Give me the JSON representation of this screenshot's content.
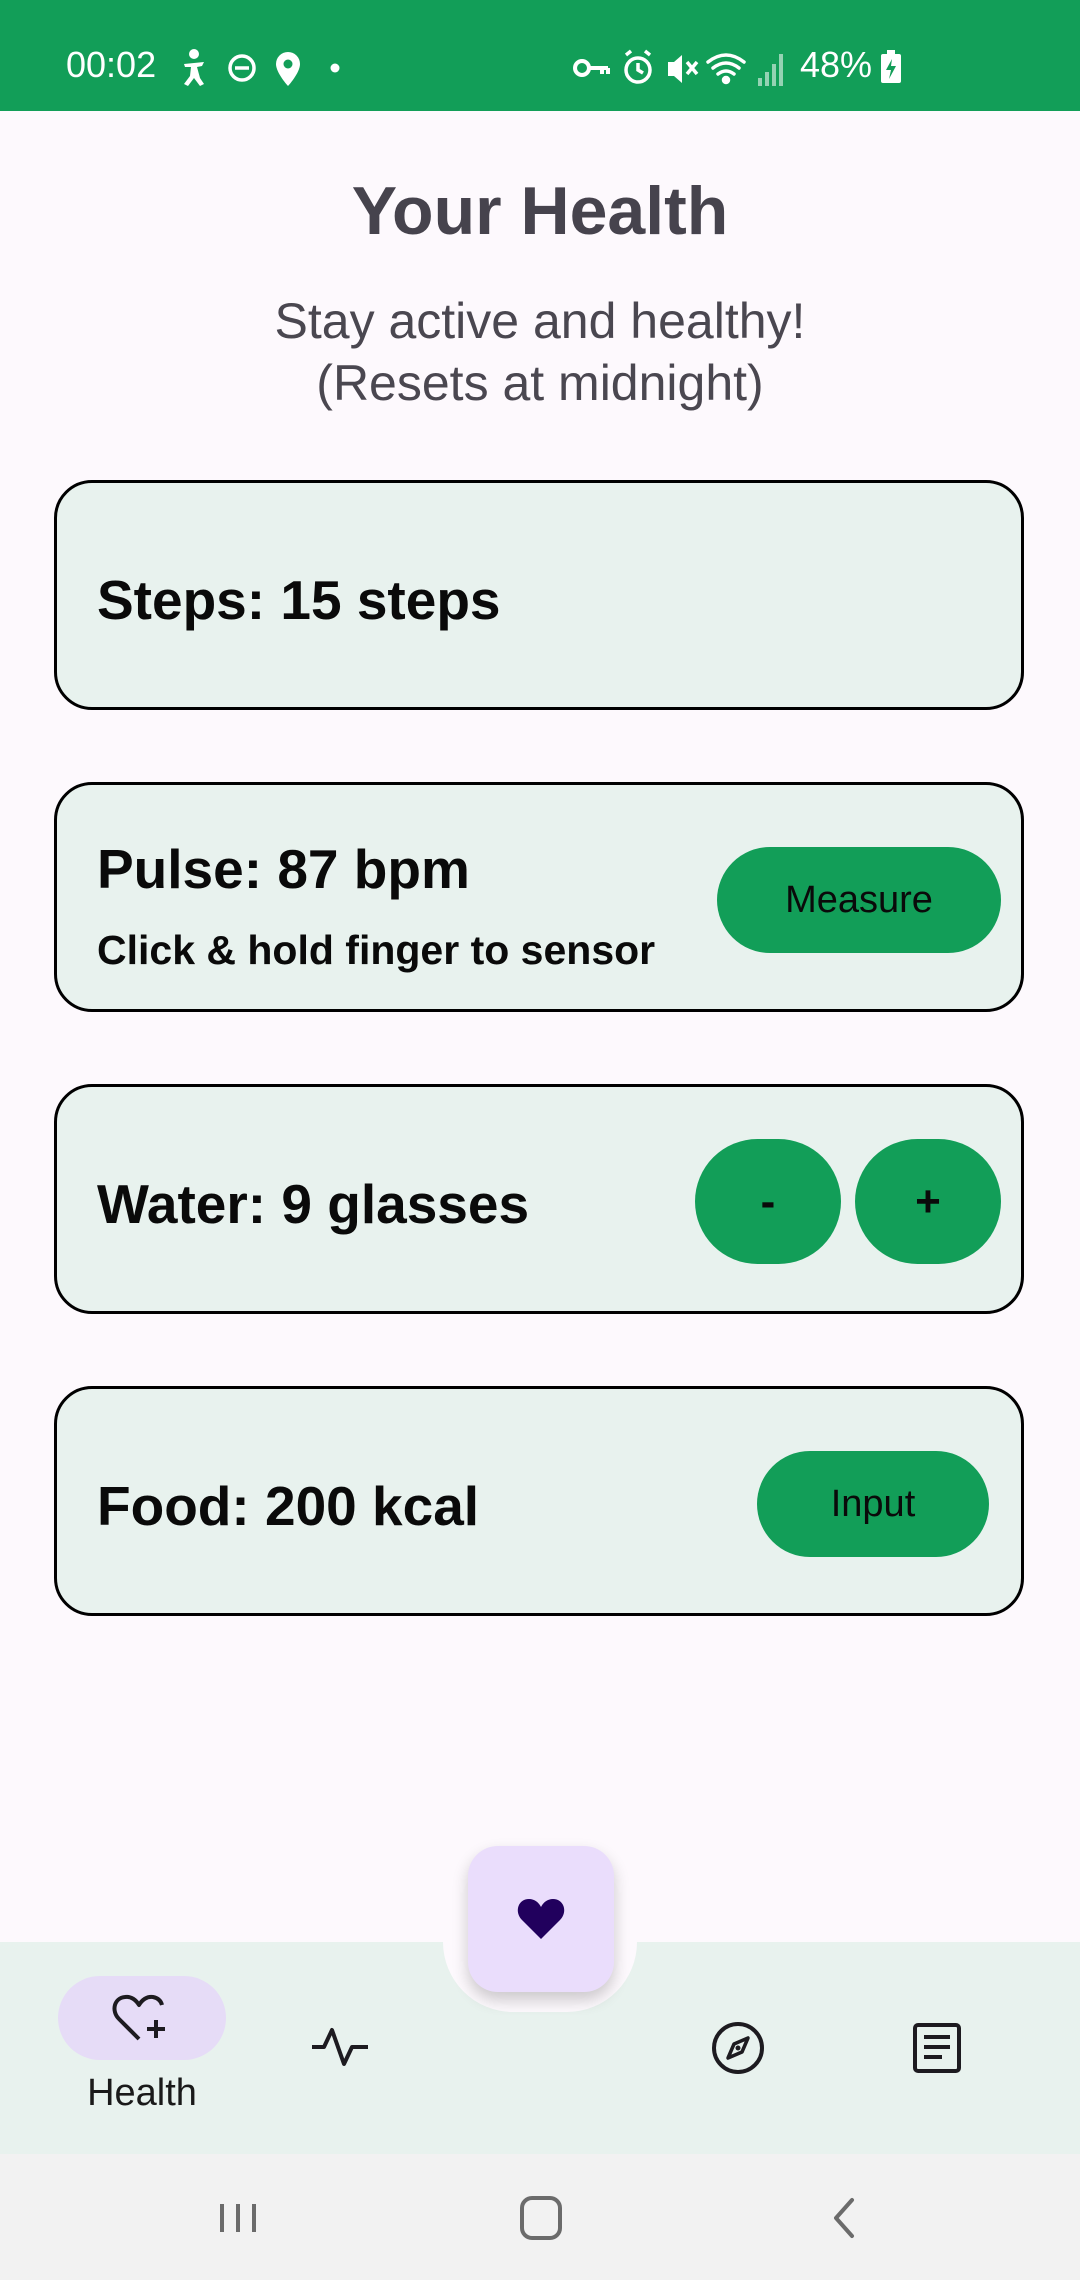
{
  "status_bar": {
    "time": "00:02",
    "battery_percent": "48%",
    "left_icons": [
      "accessibility-icon",
      "dnd-icon",
      "location-icon",
      "dot-icon"
    ],
    "right_icons": [
      "vpn-key-icon",
      "alarm-icon",
      "mute-icon",
      "wifi-icon",
      "signal-icon",
      "battery-charging-icon"
    ]
  },
  "header": {
    "title": "Your Health",
    "subtitle_line1": "Stay active and healthy!",
    "subtitle_line2": "(Resets at midnight)"
  },
  "cards": {
    "steps": {
      "label": "Steps: 15 steps"
    },
    "pulse": {
      "label": "Pulse: 87 bpm",
      "hint": "Click & hold finger to sensor",
      "button": "Measure"
    },
    "water": {
      "label": "Water: 9 glasses",
      "minus": "-",
      "plus": "+"
    },
    "food": {
      "label": "Food: 200 kcal",
      "button": "Input"
    }
  },
  "bottom_nav": {
    "items": [
      {
        "label": "Health",
        "icon": "heart-plus-icon",
        "selected": true
      },
      {
        "label": "",
        "icon": "pulse-icon",
        "selected": false
      },
      {
        "label": "",
        "icon": "compass-icon",
        "selected": false
      },
      {
        "label": "",
        "icon": "article-icon",
        "selected": false
      }
    ],
    "fab_icon": "heart-icon"
  },
  "colors": {
    "accent": "#129e58",
    "card_bg": "#e8f2ee",
    "fab_bg": "#eaddfc",
    "nav_pill": "#e6dcf7"
  }
}
